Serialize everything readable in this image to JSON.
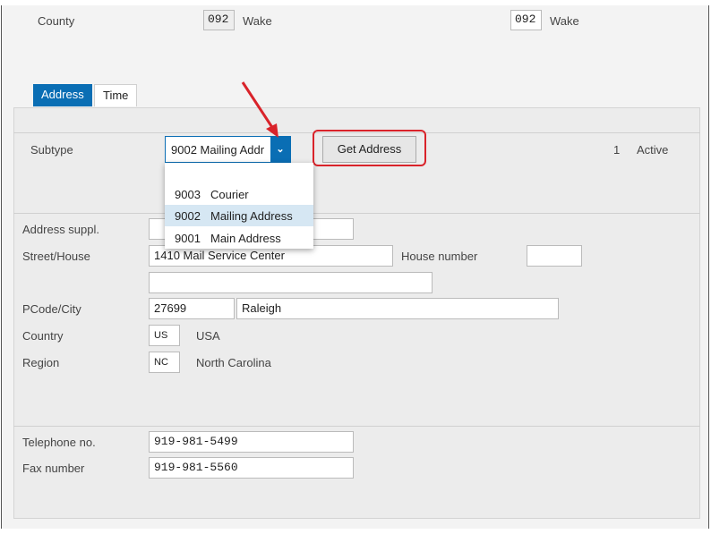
{
  "county": {
    "label": "County",
    "code_left": "092",
    "name_left": "Wake",
    "code_right": "092",
    "name_right": "Wake"
  },
  "tabs": [
    {
      "label": "Address",
      "active": true
    },
    {
      "label": "Time",
      "active": false
    }
  ],
  "subtype": {
    "label": "Subtype",
    "value": "9002 Mailing Address",
    "display": "9002 Mailing Addr",
    "options": [
      {
        "key": "9003",
        "text": "Courier"
      },
      {
        "key": "9002",
        "text": "Mailing Address",
        "selected": true
      },
      {
        "key": "9001",
        "text": "Main Address"
      }
    ]
  },
  "get_address_label": "Get Address",
  "status": {
    "number": "1",
    "text": "Active"
  },
  "fields": {
    "address_suppl": {
      "label": "Address suppl.",
      "value": ""
    },
    "street": {
      "label": "Street/House",
      "value": "1410 Mail Service Center"
    },
    "house_number": {
      "label": "House number",
      "value": ""
    },
    "street2": {
      "value": ""
    },
    "pcode_city": {
      "label": "PCode/City",
      "pcode": "27699",
      "city": "Raleigh"
    },
    "country": {
      "label": "Country",
      "code": "US",
      "name": "USA"
    },
    "region": {
      "label": "Region",
      "code": "NC",
      "name": "North Carolina"
    },
    "telephone": {
      "label": "Telephone no.",
      "value": "919-981-5499"
    },
    "fax": {
      "label": "Fax number",
      "value": "919-981-5560"
    }
  },
  "colors": {
    "accent": "#0a6eb4",
    "highlight": "#d6e7f3",
    "annotation": "#d9232a"
  }
}
